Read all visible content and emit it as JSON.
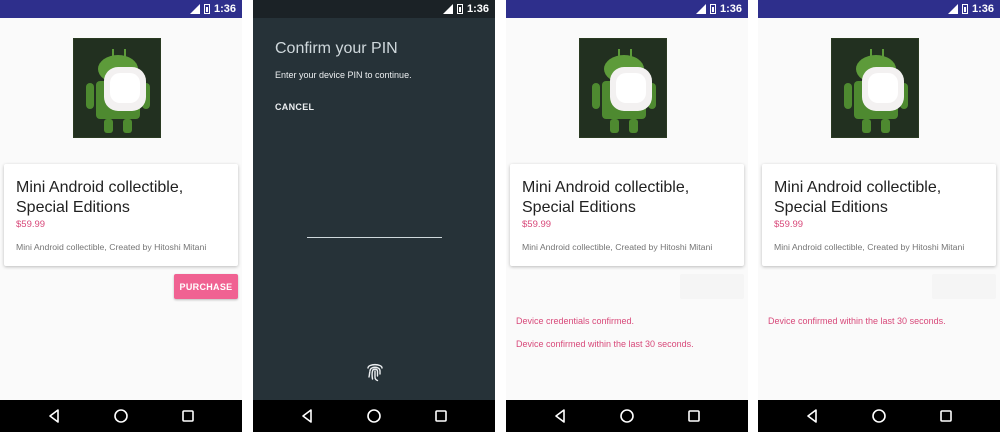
{
  "colors": {
    "status_bar": "#2e2f8c",
    "accent_pink": "#f06292",
    "price_pink": "#d8497a",
    "dark_bg": "#263238",
    "nav_bar": "#000000"
  },
  "status_bar": {
    "time": "1:36",
    "icons": [
      "signal-icon",
      "battery-icon"
    ]
  },
  "product": {
    "title": "Mini Android collectible, Special Editions",
    "price": "$59.99",
    "description": "Mini Android collectible, Created by Hitoshi Mitani",
    "image": "android-marshmallow-figure"
  },
  "purchase_button": {
    "label": "PURCHASE"
  },
  "pin_dialog": {
    "title": "Confirm your PIN",
    "subtitle": "Enter your device PIN to continue.",
    "cancel_label": "CANCEL",
    "icon": "fingerprint-icon"
  },
  "screen3": {
    "messages": [
      "Device credentials confirmed.",
      "Device confirmed within the last 30 seconds."
    ]
  },
  "screen4": {
    "messages": [
      "Device confirmed within the last 30 seconds."
    ]
  },
  "nav": {
    "buttons": [
      "back-icon",
      "home-icon",
      "recents-icon"
    ]
  }
}
